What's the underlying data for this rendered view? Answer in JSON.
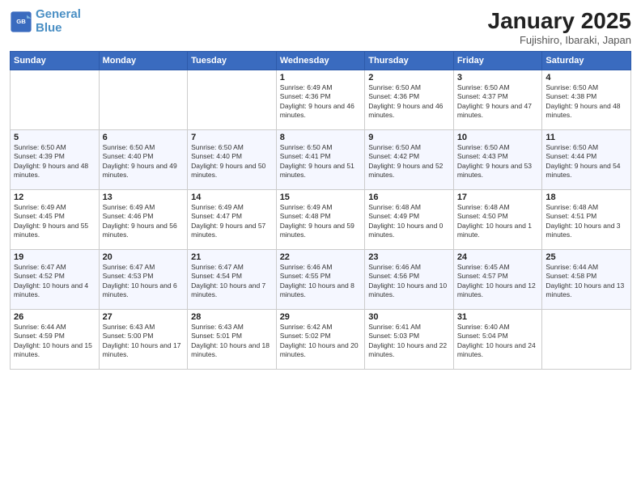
{
  "logo": {
    "line1": "General",
    "line2": "Blue"
  },
  "title": "January 2025",
  "subtitle": "Fujishiro, Ibaraki, Japan",
  "weekdays": [
    "Sunday",
    "Monday",
    "Tuesday",
    "Wednesday",
    "Thursday",
    "Friday",
    "Saturday"
  ],
  "weeks": [
    [
      {
        "day": "",
        "info": ""
      },
      {
        "day": "",
        "info": ""
      },
      {
        "day": "",
        "info": ""
      },
      {
        "day": "1",
        "info": "Sunrise: 6:49 AM\nSunset: 4:36 PM\nDaylight: 9 hours and 46 minutes."
      },
      {
        "day": "2",
        "info": "Sunrise: 6:50 AM\nSunset: 4:36 PM\nDaylight: 9 hours and 46 minutes."
      },
      {
        "day": "3",
        "info": "Sunrise: 6:50 AM\nSunset: 4:37 PM\nDaylight: 9 hours and 47 minutes."
      },
      {
        "day": "4",
        "info": "Sunrise: 6:50 AM\nSunset: 4:38 PM\nDaylight: 9 hours and 48 minutes."
      }
    ],
    [
      {
        "day": "5",
        "info": "Sunrise: 6:50 AM\nSunset: 4:39 PM\nDaylight: 9 hours and 48 minutes."
      },
      {
        "day": "6",
        "info": "Sunrise: 6:50 AM\nSunset: 4:40 PM\nDaylight: 9 hours and 49 minutes."
      },
      {
        "day": "7",
        "info": "Sunrise: 6:50 AM\nSunset: 4:40 PM\nDaylight: 9 hours and 50 minutes."
      },
      {
        "day": "8",
        "info": "Sunrise: 6:50 AM\nSunset: 4:41 PM\nDaylight: 9 hours and 51 minutes."
      },
      {
        "day": "9",
        "info": "Sunrise: 6:50 AM\nSunset: 4:42 PM\nDaylight: 9 hours and 52 minutes."
      },
      {
        "day": "10",
        "info": "Sunrise: 6:50 AM\nSunset: 4:43 PM\nDaylight: 9 hours and 53 minutes."
      },
      {
        "day": "11",
        "info": "Sunrise: 6:50 AM\nSunset: 4:44 PM\nDaylight: 9 hours and 54 minutes."
      }
    ],
    [
      {
        "day": "12",
        "info": "Sunrise: 6:49 AM\nSunset: 4:45 PM\nDaylight: 9 hours and 55 minutes."
      },
      {
        "day": "13",
        "info": "Sunrise: 6:49 AM\nSunset: 4:46 PM\nDaylight: 9 hours and 56 minutes."
      },
      {
        "day": "14",
        "info": "Sunrise: 6:49 AM\nSunset: 4:47 PM\nDaylight: 9 hours and 57 minutes."
      },
      {
        "day": "15",
        "info": "Sunrise: 6:49 AM\nSunset: 4:48 PM\nDaylight: 9 hours and 59 minutes."
      },
      {
        "day": "16",
        "info": "Sunrise: 6:48 AM\nSunset: 4:49 PM\nDaylight: 10 hours and 0 minutes."
      },
      {
        "day": "17",
        "info": "Sunrise: 6:48 AM\nSunset: 4:50 PM\nDaylight: 10 hours and 1 minute."
      },
      {
        "day": "18",
        "info": "Sunrise: 6:48 AM\nSunset: 4:51 PM\nDaylight: 10 hours and 3 minutes."
      }
    ],
    [
      {
        "day": "19",
        "info": "Sunrise: 6:47 AM\nSunset: 4:52 PM\nDaylight: 10 hours and 4 minutes."
      },
      {
        "day": "20",
        "info": "Sunrise: 6:47 AM\nSunset: 4:53 PM\nDaylight: 10 hours and 6 minutes."
      },
      {
        "day": "21",
        "info": "Sunrise: 6:47 AM\nSunset: 4:54 PM\nDaylight: 10 hours and 7 minutes."
      },
      {
        "day": "22",
        "info": "Sunrise: 6:46 AM\nSunset: 4:55 PM\nDaylight: 10 hours and 8 minutes."
      },
      {
        "day": "23",
        "info": "Sunrise: 6:46 AM\nSunset: 4:56 PM\nDaylight: 10 hours and 10 minutes."
      },
      {
        "day": "24",
        "info": "Sunrise: 6:45 AM\nSunset: 4:57 PM\nDaylight: 10 hours and 12 minutes."
      },
      {
        "day": "25",
        "info": "Sunrise: 6:44 AM\nSunset: 4:58 PM\nDaylight: 10 hours and 13 minutes."
      }
    ],
    [
      {
        "day": "26",
        "info": "Sunrise: 6:44 AM\nSunset: 4:59 PM\nDaylight: 10 hours and 15 minutes."
      },
      {
        "day": "27",
        "info": "Sunrise: 6:43 AM\nSunset: 5:00 PM\nDaylight: 10 hours and 17 minutes."
      },
      {
        "day": "28",
        "info": "Sunrise: 6:43 AM\nSunset: 5:01 PM\nDaylight: 10 hours and 18 minutes."
      },
      {
        "day": "29",
        "info": "Sunrise: 6:42 AM\nSunset: 5:02 PM\nDaylight: 10 hours and 20 minutes."
      },
      {
        "day": "30",
        "info": "Sunrise: 6:41 AM\nSunset: 5:03 PM\nDaylight: 10 hours and 22 minutes."
      },
      {
        "day": "31",
        "info": "Sunrise: 6:40 AM\nSunset: 5:04 PM\nDaylight: 10 hours and 24 minutes."
      },
      {
        "day": "",
        "info": ""
      }
    ]
  ]
}
